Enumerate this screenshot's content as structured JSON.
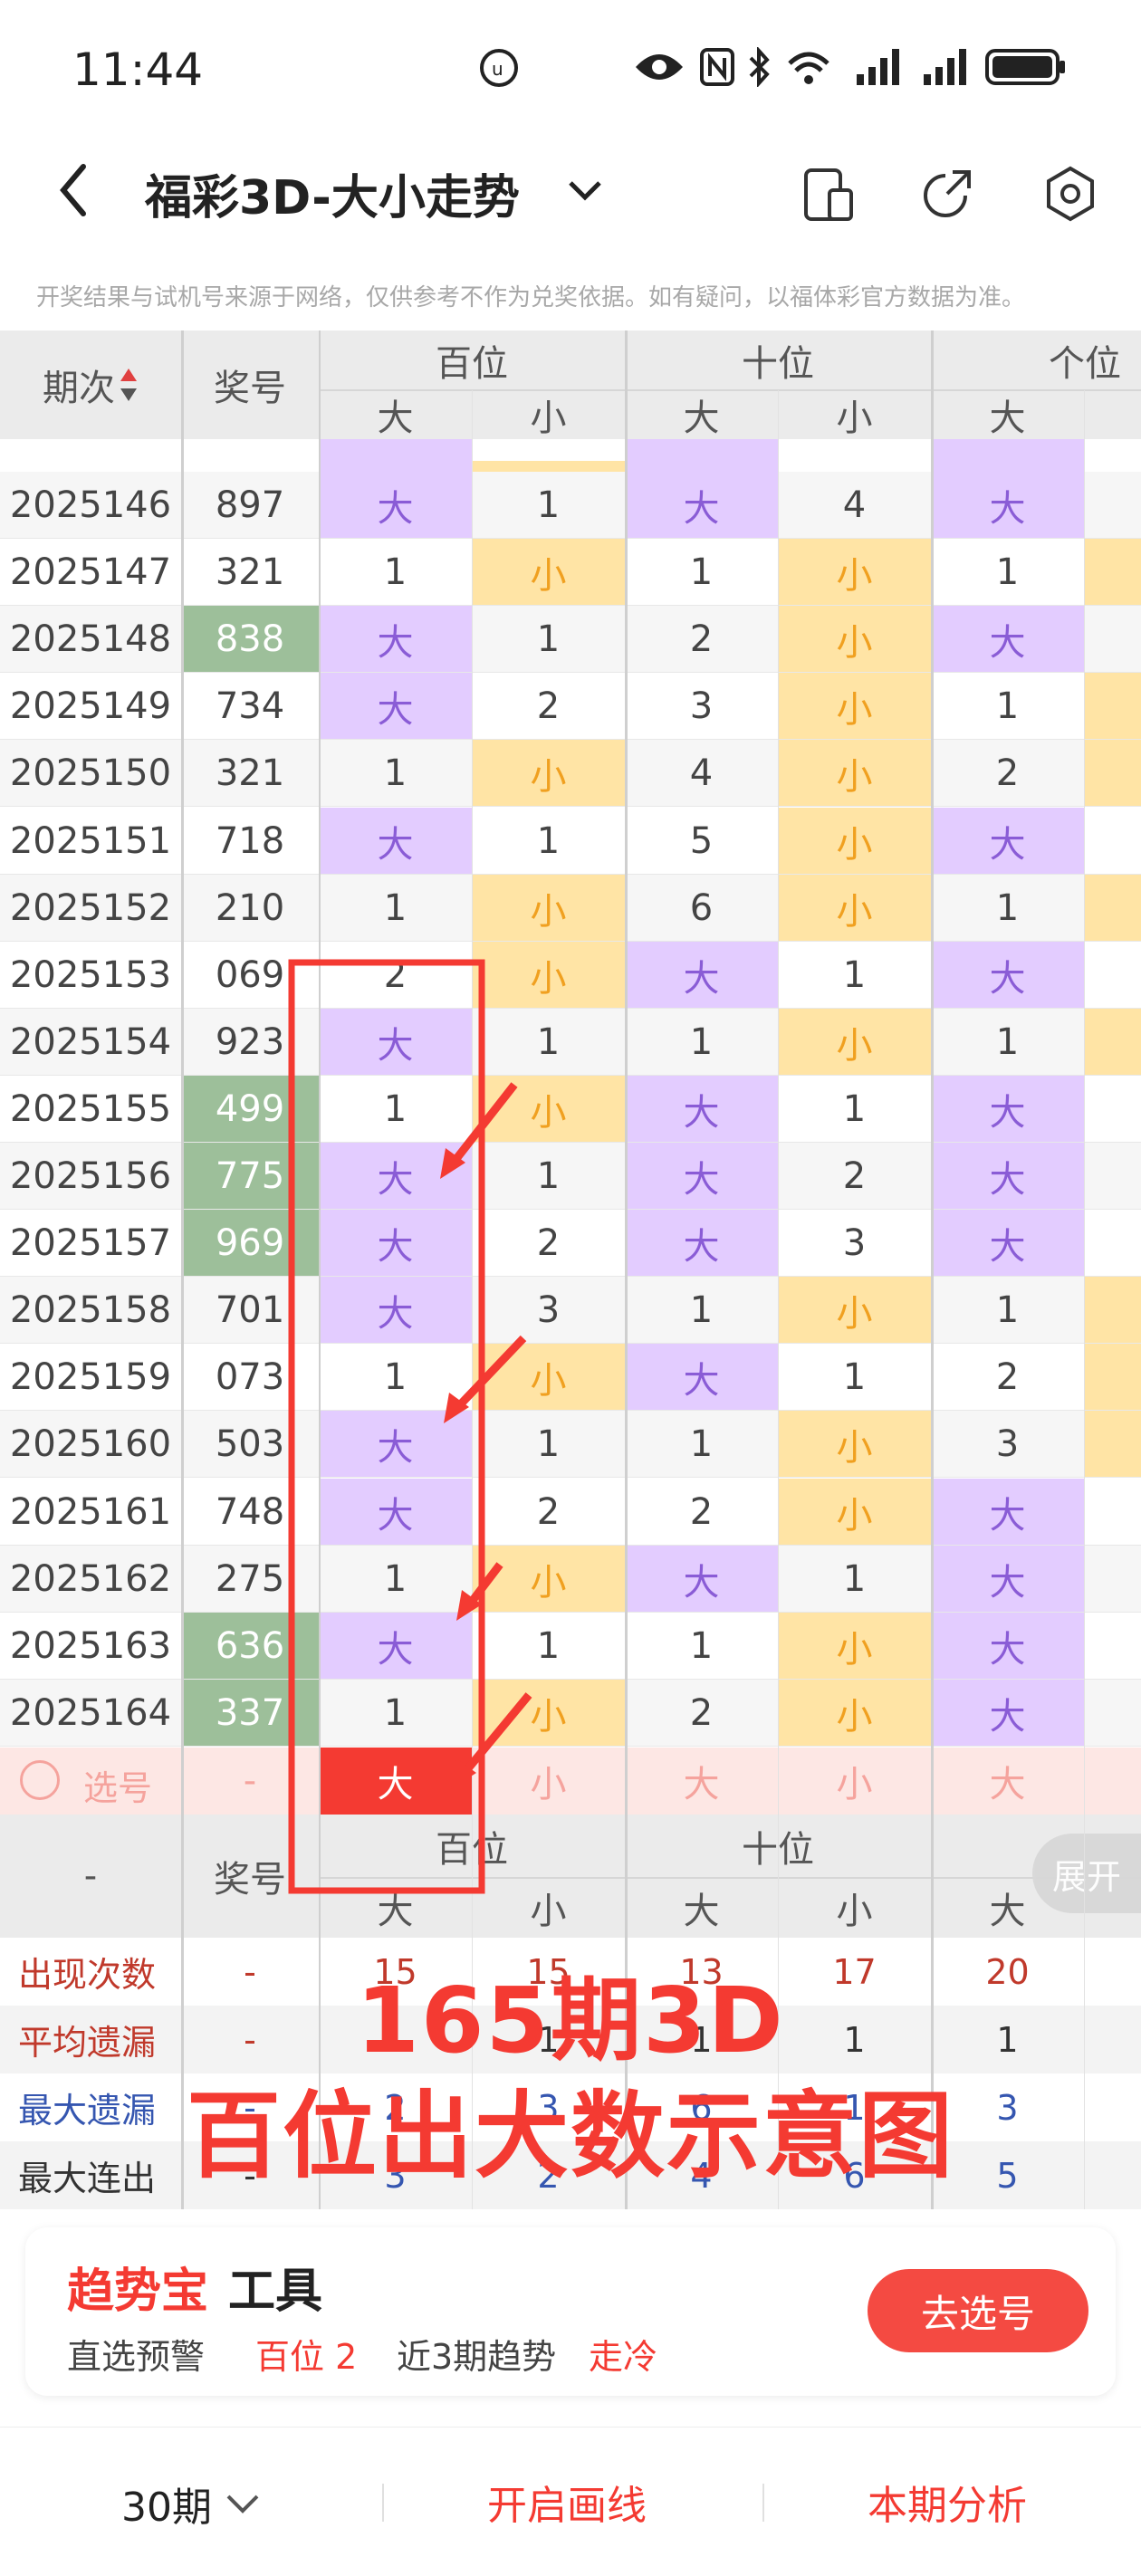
{
  "status": {
    "time": "11:44"
  },
  "nav": {
    "title": "福彩3D-大小走势"
  },
  "disclaimer": "开奖结果与试机号来源于网络，仅供参考不作为兑奖依据。如有疑问，以福体彩官方数据为准。",
  "headers": {
    "period": "期次",
    "number": "奖号",
    "hundreds": "百位",
    "tens": "十位",
    "ones": "个位",
    "big": "大",
    "small": "小"
  },
  "rows": [
    {
      "period": "2025146",
      "num": "897",
      "h": [
        "大",
        "1"
      ],
      "t": [
        "大",
        "4"
      ],
      "o": [
        "大",
        ""
      ]
    },
    {
      "period": "2025147",
      "num": "321",
      "h": [
        "1",
        "小"
      ],
      "t": [
        "1",
        "小"
      ],
      "o": [
        "1",
        ""
      ]
    },
    {
      "period": "2025148",
      "num": "838",
      "h": [
        "大",
        "1"
      ],
      "t": [
        "2",
        "小"
      ],
      "o": [
        "大",
        ""
      ]
    },
    {
      "period": "2025149",
      "num": "734",
      "h": [
        "大",
        "2"
      ],
      "t": [
        "3",
        "小"
      ],
      "o": [
        "1",
        ""
      ]
    },
    {
      "period": "2025150",
      "num": "321",
      "h": [
        "1",
        "小"
      ],
      "t": [
        "4",
        "小"
      ],
      "o": [
        "2",
        ""
      ]
    },
    {
      "period": "2025151",
      "num": "718",
      "h": [
        "大",
        "1"
      ],
      "t": [
        "5",
        "小"
      ],
      "o": [
        "大",
        ""
      ]
    },
    {
      "period": "2025152",
      "num": "210",
      "h": [
        "1",
        "小"
      ],
      "t": [
        "6",
        "小"
      ],
      "o": [
        "1",
        ""
      ]
    },
    {
      "period": "2025153",
      "num": "069",
      "h": [
        "2",
        "小"
      ],
      "t": [
        "大",
        "1"
      ],
      "o": [
        "大",
        ""
      ]
    },
    {
      "period": "2025154",
      "num": "923",
      "h": [
        "大",
        "1"
      ],
      "t": [
        "1",
        "小"
      ],
      "o": [
        "1",
        ""
      ]
    },
    {
      "period": "2025155",
      "num": "499",
      "h": [
        "1",
        "小"
      ],
      "t": [
        "大",
        "1"
      ],
      "o": [
        "大",
        ""
      ]
    },
    {
      "period": "2025156",
      "num": "775",
      "h": [
        "大",
        "1"
      ],
      "t": [
        "大",
        "2"
      ],
      "o": [
        "大",
        ""
      ]
    },
    {
      "period": "2025157",
      "num": "969",
      "h": [
        "大",
        "2"
      ],
      "t": [
        "大",
        "3"
      ],
      "o": [
        "大",
        ""
      ]
    },
    {
      "period": "2025158",
      "num": "701",
      "h": [
        "大",
        "3"
      ],
      "t": [
        "1",
        "小"
      ],
      "o": [
        "1",
        ""
      ]
    },
    {
      "period": "2025159",
      "num": "073",
      "h": [
        "1",
        "小"
      ],
      "t": [
        "大",
        "1"
      ],
      "o": [
        "2",
        ""
      ]
    },
    {
      "period": "2025160",
      "num": "503",
      "h": [
        "大",
        "1"
      ],
      "t": [
        "1",
        "小"
      ],
      "o": [
        "3",
        ""
      ]
    },
    {
      "period": "2025161",
      "num": "748",
      "h": [
        "大",
        "2"
      ],
      "t": [
        "2",
        "小"
      ],
      "o": [
        "大",
        ""
      ]
    },
    {
      "period": "2025162",
      "num": "275",
      "h": [
        "1",
        "小"
      ],
      "t": [
        "大",
        "1"
      ],
      "o": [
        "大",
        ""
      ]
    },
    {
      "period": "2025163",
      "num": "636",
      "h": [
        "大",
        "1"
      ],
      "t": [
        "1",
        "小"
      ],
      "o": [
        "大",
        ""
      ]
    },
    {
      "period": "2025164",
      "num": "337",
      "h": [
        "1",
        "小"
      ],
      "t": [
        "2",
        "小"
      ],
      "o": [
        "大",
        ""
      ]
    }
  ],
  "select_row": {
    "label": "选号",
    "num": "-",
    "cells": [
      "大",
      "小",
      "大",
      "小",
      "大"
    ]
  },
  "footer_header": {
    "dash": "-",
    "number": "奖号",
    "expand": "展开"
  },
  "stats": [
    {
      "label": "出现次数",
      "dash": "-",
      "vals": [
        "15",
        "15",
        "13",
        "17",
        "20"
      ]
    },
    {
      "label": "平均遗漏",
      "dash": "-",
      "vals": [
        "1",
        "1",
        "1",
        "1",
        "1"
      ]
    },
    {
      "label": "最大遗漏",
      "dash": "-",
      "vals": [
        "2",
        "3",
        "6",
        "1",
        "3"
      ]
    },
    {
      "label": "最大连出",
      "dash": "-",
      "vals": [
        "3",
        "2",
        "4",
        "6",
        "5"
      ]
    }
  ],
  "overlay": {
    "line1": "165期3D",
    "line2": "百位出大数示意图"
  },
  "promo": {
    "brand": "趋势宝",
    "tool": "工具",
    "warn_label": "直选预警",
    "warn_value": "百位 2",
    "trend_label": "近3期趋势",
    "trend_value": "走冷",
    "button": "去选号"
  },
  "bottom": {
    "periods": "30期",
    "draw": "开启画线",
    "analysis": "本期分析"
  },
  "colors": {
    "big_bg": "#e3ccff",
    "big_text": "#8a5cd6",
    "small_bg": "#ffe4a5",
    "small_text": "#f0a020",
    "green": "#9dbf9a",
    "red": "#f43a32"
  }
}
